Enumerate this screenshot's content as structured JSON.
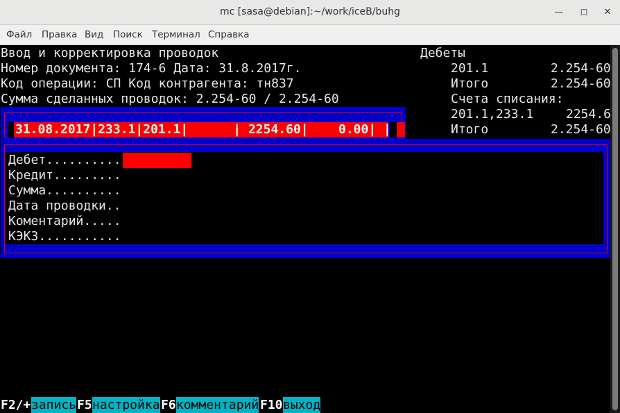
{
  "window": {
    "title": "mc [sasa@debian]:~/work/iceB/buhg",
    "minimize_icon": "minimize-icon",
    "maximize_icon": "maximize-icon",
    "close_icon": "close-icon"
  },
  "menu": [
    "Файл",
    "Правка",
    "Вид",
    "Поиск",
    "Терминал",
    "Справка"
  ],
  "header": {
    "line1": "Ввод и корректировка проводок",
    "line2": "Номер документа: 174-6 Дата: 31.8.2017г.",
    "line3": "Код операции: СП Код контрагента: тн837",
    "line4": "Сумма сделанных проводок: 2.254-60 / 2.254-60"
  },
  "right_panel": {
    "title": "Дебеты",
    "row1_account": "201.1",
    "row1_amount": "2.254-60",
    "row2_label": "Итого",
    "row2_amount": "2.254-60",
    "section": "Счета списания:",
    "row3_account": "201.1,233.1",
    "row3_amount": "2254.6",
    "row4_label": "Итого",
    "row4_amount": "2.254-60"
  },
  "entry_row": "31.08.2017|233.1|201.1|      | 2254.60|    0.00| |",
  "form": {
    "debit": "Дебет..........",
    "credit": "Кредит.........",
    "sum": "Сумма..........",
    "date": "Дата проводки..",
    "comment": "Коментарий.....",
    "kekz": "КЭКЗ..........."
  },
  "fkeys": [
    {
      "key": "F2/+",
      "label": "запись"
    },
    {
      "key": "F5",
      "label": "настройка"
    },
    {
      "key": "F6",
      "label": "комментарий"
    },
    {
      "key": "F10",
      "label": "выход"
    }
  ]
}
